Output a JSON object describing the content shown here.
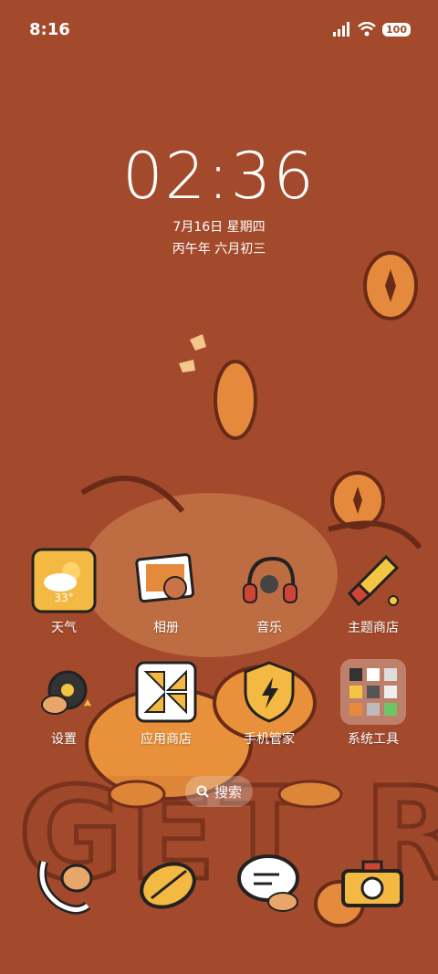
{
  "status_bar": {
    "time": "8:16",
    "battery": "100",
    "icons": [
      "signal-icon",
      "wifi-icon",
      "battery-icon"
    ]
  },
  "lockscreen": {
    "clock": "02:36",
    "date": "7月16日 星期四",
    "lunar_date": "丙午年 六月初三"
  },
  "wallpaper": {
    "text": "GET RICH",
    "colors": {
      "background": "#a44a2c",
      "coin": "#e58a3c",
      "outline": "#6a2a18"
    }
  },
  "apps": [
    {
      "label": "天气",
      "icon": "weather-icon",
      "badge": "33°"
    },
    {
      "label": "相册",
      "icon": "gallery-icon"
    },
    {
      "label": "音乐",
      "icon": "music-icon"
    },
    {
      "label": "主题商店",
      "icon": "theme-store-icon"
    },
    {
      "label": "设置",
      "icon": "settings-icon"
    },
    {
      "label": "应用商店",
      "icon": "app-store-icon"
    },
    {
      "label": "手机管家",
      "icon": "security-icon"
    },
    {
      "label": "系统工具",
      "icon": "system-tools-folder-icon"
    }
  ],
  "search": {
    "label": "搜索",
    "icon": "search-icon"
  },
  "dock": [
    {
      "icon": "phone-icon"
    },
    {
      "icon": "browser-icon"
    },
    {
      "icon": "messages-icon"
    },
    {
      "icon": "camera-icon"
    }
  ]
}
